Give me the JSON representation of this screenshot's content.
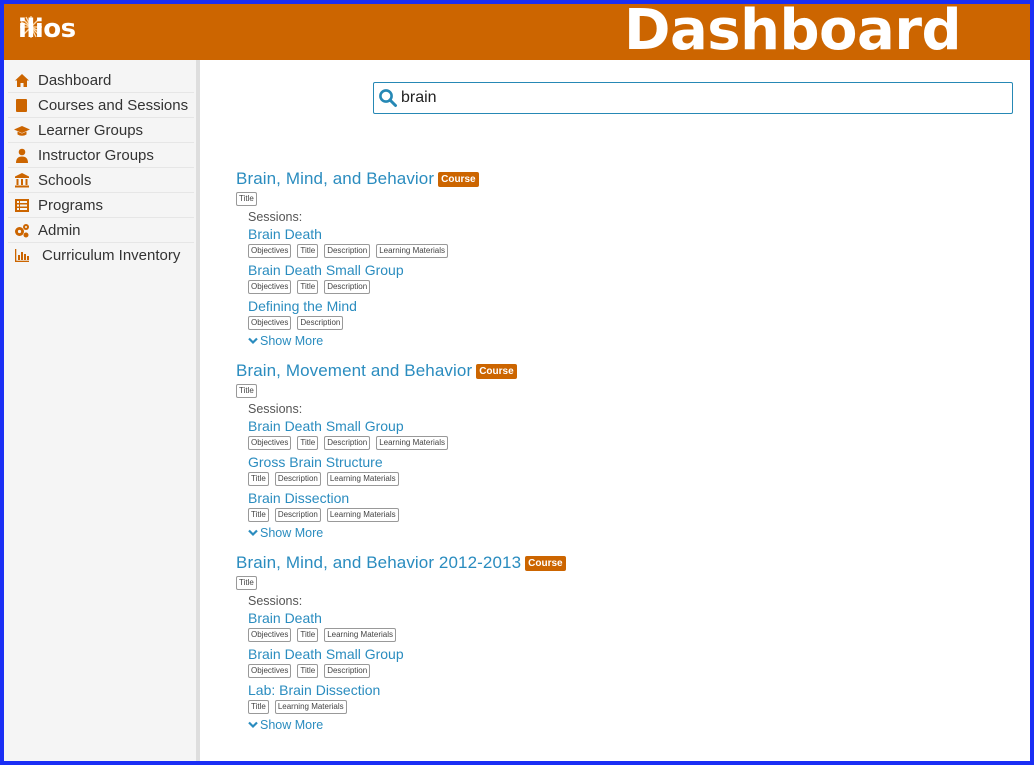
{
  "header": {
    "logo_text": "ilios",
    "page_title": "Dashboard",
    "colors": {
      "brand": "#cc6500",
      "frame": "#1a2ef5",
      "link": "#2a8cbf"
    }
  },
  "sidebar": {
    "items": [
      {
        "label": "Dashboard",
        "icon": "home-icon"
      },
      {
        "label": "Courses and Sessions",
        "icon": "book-icon"
      },
      {
        "label": "Learner Groups",
        "icon": "graduation-cap-icon"
      },
      {
        "label": "Instructor Groups",
        "icon": "user-tie-icon"
      },
      {
        "label": "Schools",
        "icon": "university-icon"
      },
      {
        "label": "Programs",
        "icon": "list-alt-icon"
      },
      {
        "label": "Admin",
        "icon": "cogs-icon"
      },
      {
        "label": "Curriculum Inventory",
        "icon": "bar-chart-icon"
      }
    ]
  },
  "search": {
    "value": "brain",
    "icon": "search-icon"
  },
  "results": [
    {
      "title": "Brain, Mind, and Behavior",
      "badge": "Course",
      "tags": [
        "Title"
      ],
      "sessions_label": "Sessions:",
      "sessions": [
        {
          "title": "Brain Death",
          "tags": [
            "Objectives",
            "Title",
            "Description",
            "Learning Materials"
          ]
        },
        {
          "title": "Brain Death Small Group",
          "tags": [
            "Objectives",
            "Title",
            "Description"
          ]
        },
        {
          "title": "Defining the Mind",
          "tags": [
            "Objectives",
            "Description"
          ]
        }
      ],
      "show_more": "Show More"
    },
    {
      "title": "Brain, Movement and Behavior",
      "badge": "Course",
      "tags": [
        "Title"
      ],
      "sessions_label": "Sessions:",
      "sessions": [
        {
          "title": "Brain Death Small Group",
          "tags": [
            "Objectives",
            "Title",
            "Description",
            "Learning Materials"
          ]
        },
        {
          "title": "Gross Brain Structure",
          "tags": [
            "Title",
            "Description",
            "Learning Materials"
          ]
        },
        {
          "title": "Brain Dissection",
          "tags": [
            "Title",
            "Description",
            "Learning Materials"
          ]
        }
      ],
      "show_more": "Show More"
    },
    {
      "title": "Brain, Mind, and Behavior 2012-2013",
      "badge": "Course",
      "tags": [
        "Title"
      ],
      "sessions_label": "Sessions:",
      "sessions": [
        {
          "title": "Brain Death",
          "tags": [
            "Objectives",
            "Title",
            "Learning Materials"
          ]
        },
        {
          "title": "Brain Death Small Group",
          "tags": [
            "Objectives",
            "Title",
            "Description"
          ]
        },
        {
          "title": "Lab: Brain Dissection",
          "tags": [
            "Title",
            "Learning Materials"
          ]
        }
      ],
      "show_more": "Show More"
    }
  ]
}
